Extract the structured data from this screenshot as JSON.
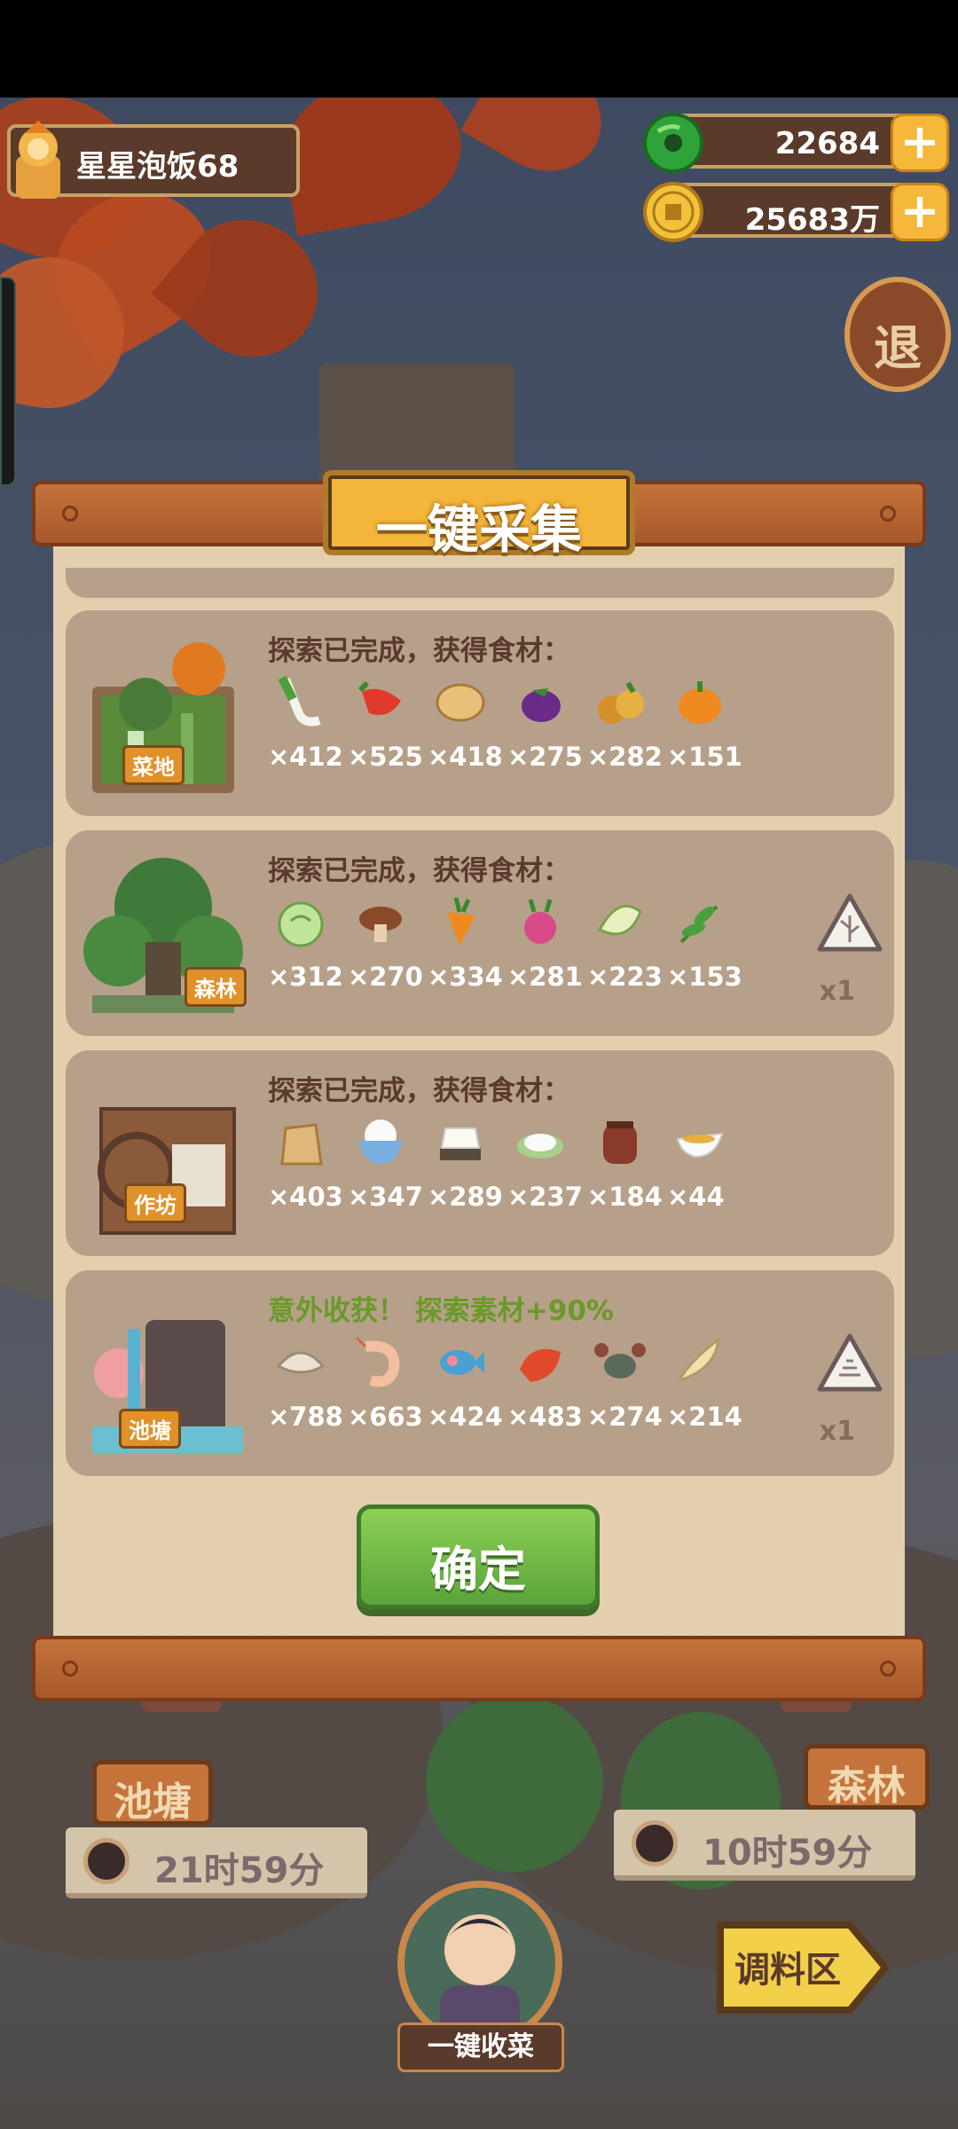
{
  "player": {
    "name": "星星泡饭68"
  },
  "currency": {
    "jade": {
      "value": "22684",
      "icon": "jade-coin-icon"
    },
    "gold": {
      "value": "25683万",
      "icon": "gold-coin-icon"
    }
  },
  "exit_label": "退",
  "modal": {
    "title": "一键采集",
    "confirm_label": "确定",
    "cards": [
      {
        "area": "菜地",
        "title": "探索已完成，获得食材：",
        "bonus": false,
        "items": [
          {
            "icon": "leek-icon",
            "count": "×412"
          },
          {
            "icon": "chili-pepper-icon",
            "count": "×525"
          },
          {
            "icon": "potato-icon",
            "count": "×418"
          },
          {
            "icon": "eggplant-icon",
            "count": "×275"
          },
          {
            "icon": "pumpkin-harvest-icon",
            "count": "×282"
          },
          {
            "icon": "pumpkin-icon",
            "count": "×151"
          }
        ]
      },
      {
        "area": "森林",
        "title": "探索已完成，获得食材：",
        "bonus": false,
        "badge_count": "x1",
        "items": [
          {
            "icon": "cabbage-icon",
            "count": "×312"
          },
          {
            "icon": "mushroom-icon",
            "count": "×270"
          },
          {
            "icon": "carrot-icon",
            "count": "×334"
          },
          {
            "icon": "radish-icon",
            "count": "×281"
          },
          {
            "icon": "bamboo-shoot-icon",
            "count": "×223"
          },
          {
            "icon": "herb-icon",
            "count": "×153"
          }
        ]
      },
      {
        "area": "作坊",
        "title": "探索已完成，获得食材：",
        "bonus": false,
        "items": [
          {
            "icon": "flour-sack-icon",
            "count": "×403"
          },
          {
            "icon": "rice-bowl-icon",
            "count": "×347"
          },
          {
            "icon": "tofu-icon",
            "count": "×289"
          },
          {
            "icon": "rice-plate-icon",
            "count": "×237"
          },
          {
            "icon": "sauce-jar-icon",
            "count": "×184"
          },
          {
            "icon": "gravy-boat-icon",
            "count": "×44"
          }
        ]
      },
      {
        "area": "池塘",
        "title": "意外收获！ 探索素材+90%",
        "bonus": true,
        "badge_count": "x1",
        "items": [
          {
            "icon": "clam-icon",
            "count": "×788"
          },
          {
            "icon": "shrimp-icon",
            "count": "×663"
          },
          {
            "icon": "fish-icon",
            "count": "×424"
          },
          {
            "icon": "red-fish-icon",
            "count": "×483"
          },
          {
            "icon": "crab-icon",
            "count": "×274"
          },
          {
            "icon": "shell-icon",
            "count": "×214"
          }
        ]
      }
    ]
  },
  "bottom": {
    "pond_sign": "池塘",
    "pond_timer": "21时59分",
    "forest_sign": "森林",
    "forest_timer": "10时59分",
    "harvest_label": "一键收菜",
    "season_label": "调料区"
  }
}
